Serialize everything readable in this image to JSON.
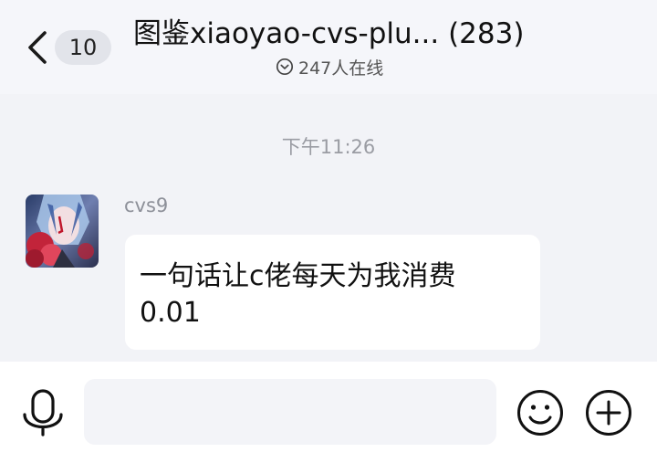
{
  "header": {
    "unread_badge": "10",
    "title": "图鉴xiaoyao-cvs-plu... (283)",
    "online_text": "247人在线"
  },
  "chat": {
    "timestamp": "下午11:26",
    "messages": [
      {
        "sender": "cvs9",
        "text_line1": "一句话让c佬每天为我消费",
        "text_line2": "0.01"
      }
    ]
  },
  "input": {
    "value": "",
    "placeholder": ""
  },
  "colors": {
    "header_bg": "#f5f6fa",
    "chat_bg": "#f2f3f7",
    "bubble_bg": "#ffffff",
    "footer_bg": "#ffffff"
  }
}
